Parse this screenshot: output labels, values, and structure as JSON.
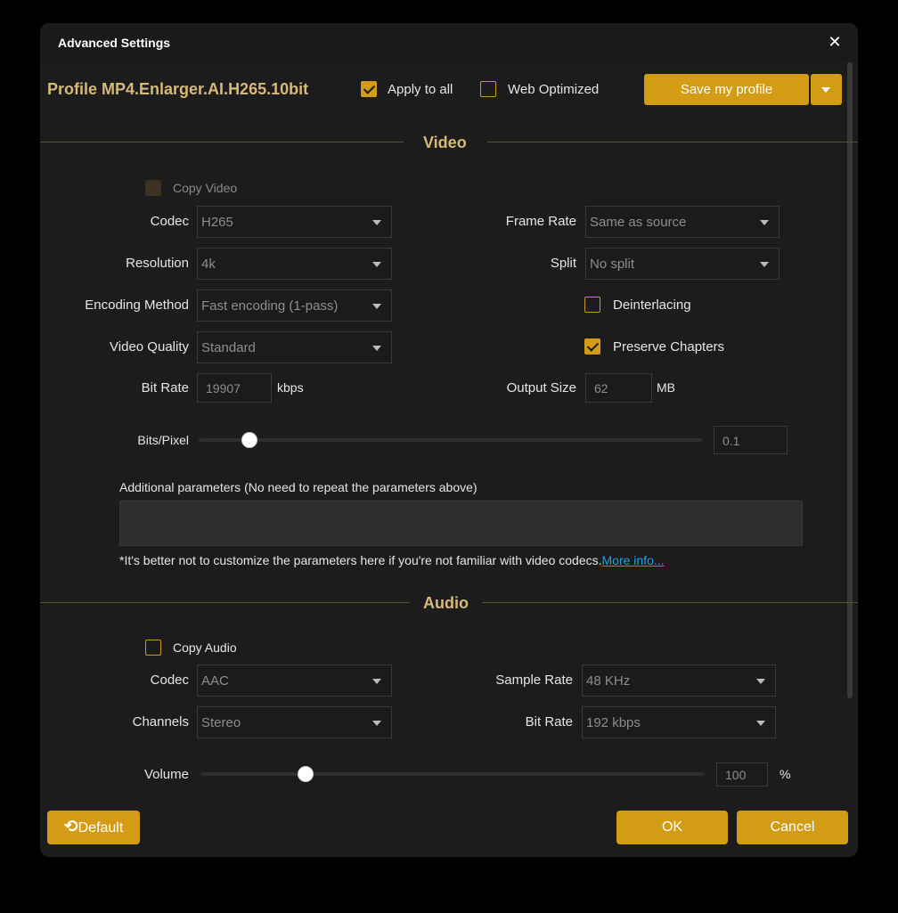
{
  "dialog": {
    "title": "Advanced Settings"
  },
  "header": {
    "profile": "Profile MP4.Enlarger.AI.H265.10bit",
    "apply_to_all": {
      "label": "Apply to all",
      "checked": true
    },
    "web_optimized": {
      "label": "Web Optimized",
      "checked": false
    },
    "save_profile_label": "Save my profile"
  },
  "video": {
    "section_title": "Video",
    "copy_video": {
      "label": "Copy Video",
      "checked": false,
      "disabled": true
    },
    "codec": {
      "label": "Codec",
      "value": "H265"
    },
    "resolution": {
      "label": "Resolution",
      "value": "4k"
    },
    "encoding_method": {
      "label": "Encoding Method",
      "value": "Fast encoding (1-pass)"
    },
    "video_quality": {
      "label": "Video Quality",
      "value": "Standard"
    },
    "bit_rate": {
      "label": "Bit Rate",
      "value": "19907",
      "unit": "kbps"
    },
    "frame_rate": {
      "label": "Frame Rate",
      "value": "Same as source"
    },
    "split": {
      "label": "Split",
      "value": "No split"
    },
    "deinterlacing": {
      "label": "Deinterlacing",
      "checked": false
    },
    "preserve_chapters": {
      "label": "Preserve Chapters",
      "checked": true
    },
    "output_size": {
      "label": "Output Size",
      "value": "62",
      "unit": "MB"
    },
    "bits_pixel": {
      "label": "Bits/Pixel",
      "value": "0.1",
      "slider_fraction": 0.1
    },
    "additional_params_label": "Additional parameters (No need to repeat the parameters above)",
    "additional_params_value": "",
    "hint": "*It's better not to customize the parameters here if you're not familiar with video codecs.",
    "more_info": "More info..."
  },
  "audio": {
    "section_title": "Audio",
    "copy_audio": {
      "label": "Copy Audio",
      "checked": false
    },
    "codec": {
      "label": "Codec",
      "value": "AAC"
    },
    "channels": {
      "label": "Channels",
      "value": "Stereo"
    },
    "sample_rate": {
      "label": "Sample Rate",
      "value": "48 KHz"
    },
    "bit_rate": {
      "label": "Bit Rate",
      "value": "192 kbps"
    },
    "volume": {
      "label": "Volume",
      "value": "100",
      "unit": "%",
      "slider_fraction": 0.2
    }
  },
  "footer": {
    "default_label": "Default",
    "ok_label": "OK",
    "cancel_label": "Cancel"
  },
  "colors": {
    "accent": "#d49b14",
    "title_gold": "#d7b978",
    "link": "#1aa3e8",
    "background": "#1c1c1c"
  },
  "icons": {
    "close": "close-icon",
    "default": "undo-icon",
    "dropdown": "chevron-down-icon"
  }
}
